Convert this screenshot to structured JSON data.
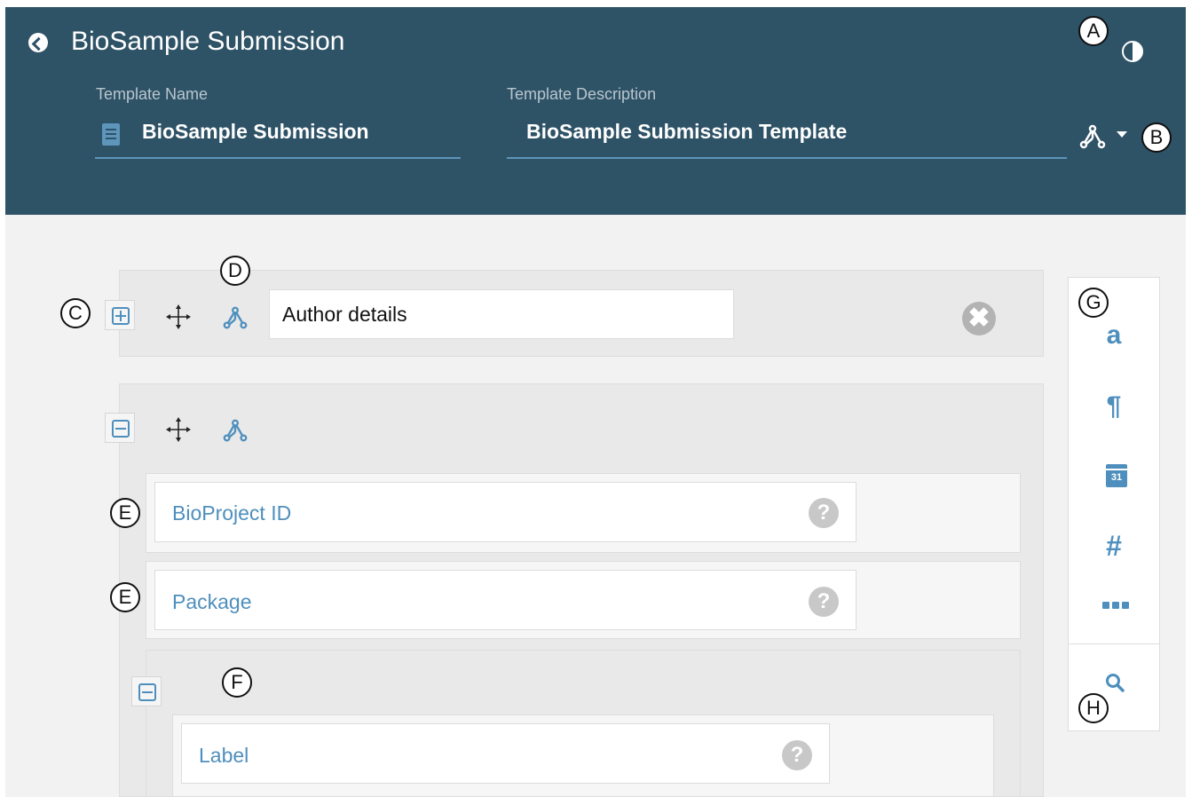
{
  "header": {
    "app_title": "BioSample Submission",
    "template_name_label": "Template Name",
    "template_name_value": "BioSample Submission",
    "template_description_label": "Template Description",
    "template_description_value": "BioSample Submission Template"
  },
  "callouts": {
    "a": "A",
    "b": "B",
    "c": "C",
    "d": "D",
    "e1": "E",
    "e2": "E",
    "f": "F",
    "g": "G",
    "h": "H"
  },
  "element_1": {
    "name_value": "Author details",
    "close_glyph": "✖"
  },
  "element_2": {
    "fields": [
      {
        "name": "BioProject ID",
        "help_glyph": "?"
      },
      {
        "name": "Package",
        "help_glyph": "?"
      }
    ],
    "nested": {
      "field_name": "Label",
      "help_glyph": "?"
    }
  },
  "toolbar": {
    "text_glyph": "a",
    "paragraph_glyph": "¶",
    "date_glyph": "31",
    "number_glyph": "#"
  },
  "icons": [
    "back-icon",
    "contrast-icon",
    "document-icon",
    "network-icon",
    "caret-down-icon",
    "expand-icon",
    "collapse-icon",
    "move-icon",
    "close-icon",
    "help-icon",
    "text-field-icon",
    "paragraph-icon",
    "calendar-icon",
    "number-icon",
    "more-icon",
    "search-icon"
  ],
  "colors": {
    "header_bg": "#2e5266",
    "accent": "#4f8fbd",
    "main_bg": "#f2f2f2"
  }
}
